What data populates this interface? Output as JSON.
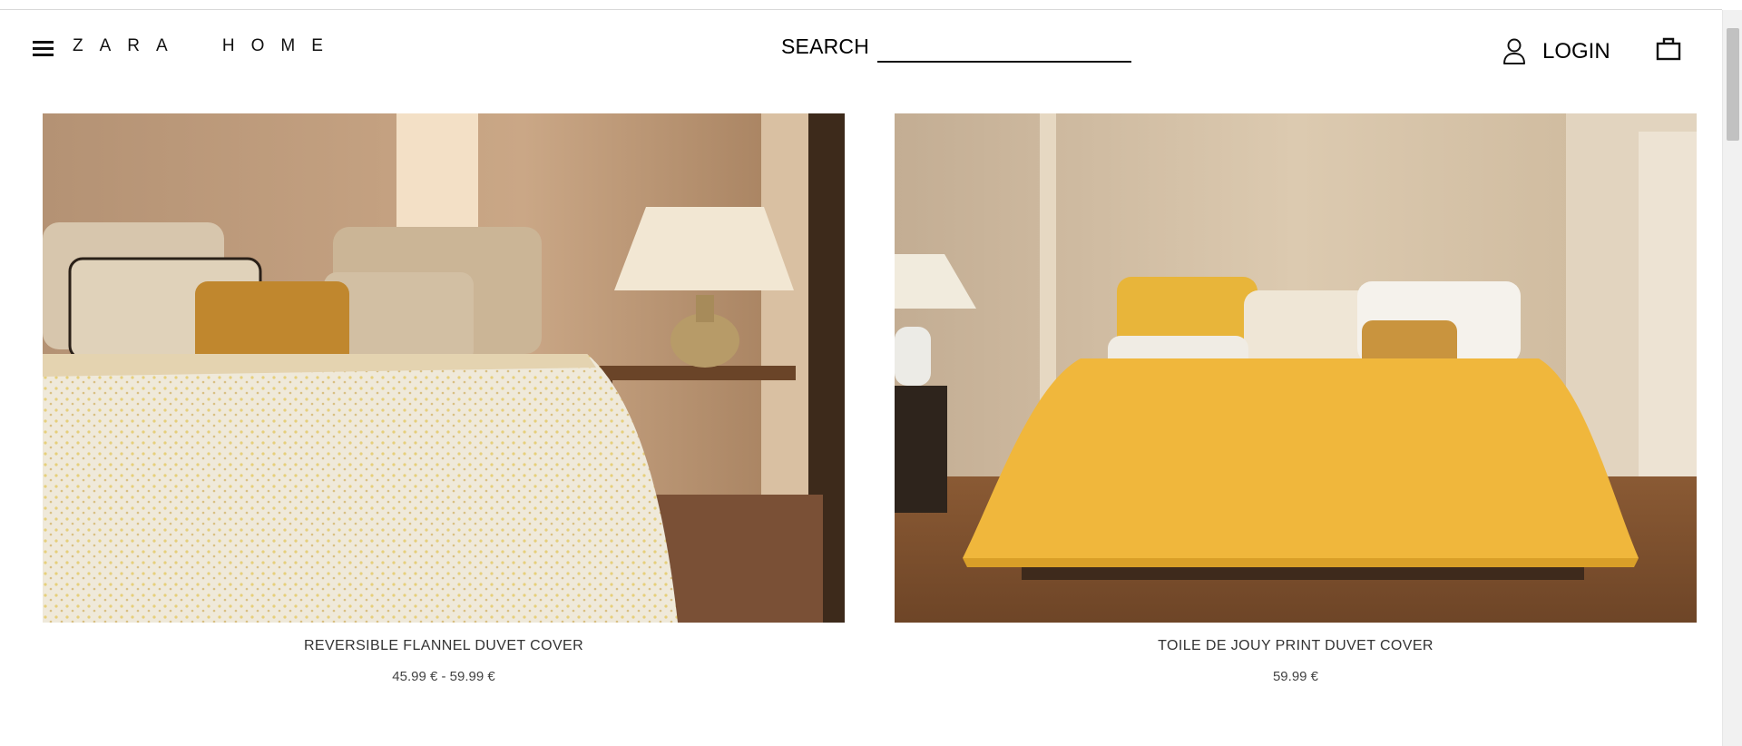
{
  "header": {
    "logo": "ZARA HOME",
    "search_label": "SEARCH",
    "search_placeholder": "",
    "login_label": "LOGIN"
  },
  "icons": {
    "menu": "hamburger-menu-icon",
    "user": "user-icon",
    "cart": "shopping-bag-icon"
  },
  "products": [
    {
      "name": "REVERSIBLE FLANNEL DUVET COVER",
      "price": "45.99 € - 59.99 €",
      "image": "bedroom with cream floral flannel duvet, beige and mustard cushions, ceramic lamp on wooden nightstand"
    },
    {
      "name": "TOILE DE JOUY PRINT DUVET COVER",
      "price": "59.99 €",
      "image": "bedroom with mustard yellow duvet, white and yellow pillows, wooden floor"
    }
  ],
  "colors": {
    "text": "#000000",
    "muted_text": "#333333",
    "background": "#ffffff"
  }
}
